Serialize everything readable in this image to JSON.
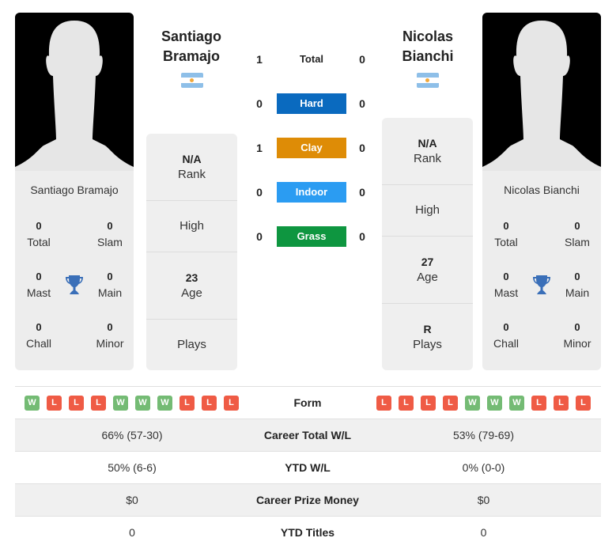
{
  "players": [
    {
      "name": "Santiago Bramajo",
      "header_name_line1": "Santiago",
      "header_name_line2": "Bramajo",
      "flag": "argentina-flag",
      "titles": {
        "total": {
          "value": "0",
          "label": "Total"
        },
        "slam": {
          "value": "0",
          "label": "Slam"
        },
        "mast": {
          "value": "0",
          "label": "Mast"
        },
        "main": {
          "value": "0",
          "label": "Main"
        },
        "chall": {
          "value": "0",
          "label": "Chall"
        },
        "minor": {
          "value": "0",
          "label": "Minor"
        }
      },
      "info": {
        "rank": {
          "value": "N/A",
          "label": "Rank"
        },
        "high": {
          "value": "",
          "label": "High"
        },
        "age": {
          "value": "23",
          "label": "Age"
        },
        "plays": {
          "value": "",
          "label": "Plays"
        }
      },
      "form": [
        "W",
        "L",
        "L",
        "L",
        "W",
        "W",
        "W",
        "L",
        "L",
        "L"
      ],
      "career_total_wl": "66% (57-30)",
      "ytd_wl": "50% (6-6)",
      "career_prize_money": "$0",
      "ytd_titles": "0"
    },
    {
      "name": "Nicolas Bianchi",
      "header_name_line1": "Nicolas",
      "header_name_line2": "Bianchi",
      "flag": "argentina-flag",
      "titles": {
        "total": {
          "value": "0",
          "label": "Total"
        },
        "slam": {
          "value": "0",
          "label": "Slam"
        },
        "mast": {
          "value": "0",
          "label": "Mast"
        },
        "main": {
          "value": "0",
          "label": "Main"
        },
        "chall": {
          "value": "0",
          "label": "Chall"
        },
        "minor": {
          "value": "0",
          "label": "Minor"
        }
      },
      "info": {
        "rank": {
          "value": "N/A",
          "label": "Rank"
        },
        "high": {
          "value": "",
          "label": "High"
        },
        "age": {
          "value": "27",
          "label": "Age"
        },
        "plays": {
          "value": "R",
          "label": "Plays"
        }
      },
      "form": [
        "L",
        "L",
        "L",
        "L",
        "W",
        "W",
        "W",
        "L",
        "L",
        "L"
      ],
      "career_total_wl": "53% (79-69)",
      "ytd_wl": "0% (0-0)",
      "career_prize_money": "$0",
      "ytd_titles": "0"
    }
  ],
  "h2h": [
    {
      "label": "Total",
      "left": "1",
      "right": "0",
      "color": ""
    },
    {
      "label": "Hard",
      "left": "0",
      "right": "0",
      "color": "#0a6abf"
    },
    {
      "label": "Clay",
      "left": "1",
      "right": "0",
      "color": "#de8c06"
    },
    {
      "label": "Indoor",
      "left": "0",
      "right": "0",
      "color": "#2b9cf2"
    },
    {
      "label": "Grass",
      "left": "0",
      "right": "0",
      "color": "#0e9640"
    }
  ],
  "stats_labels": {
    "form": "Form",
    "career_total_wl": "Career Total W/L",
    "ytd_wl": "YTD W/L",
    "career_prize_money": "Career Prize Money",
    "ytd_titles": "YTD Titles"
  },
  "colors": {
    "win": "#74bb74",
    "loss": "#ef5b45",
    "trophy": "#3a6fb8"
  }
}
